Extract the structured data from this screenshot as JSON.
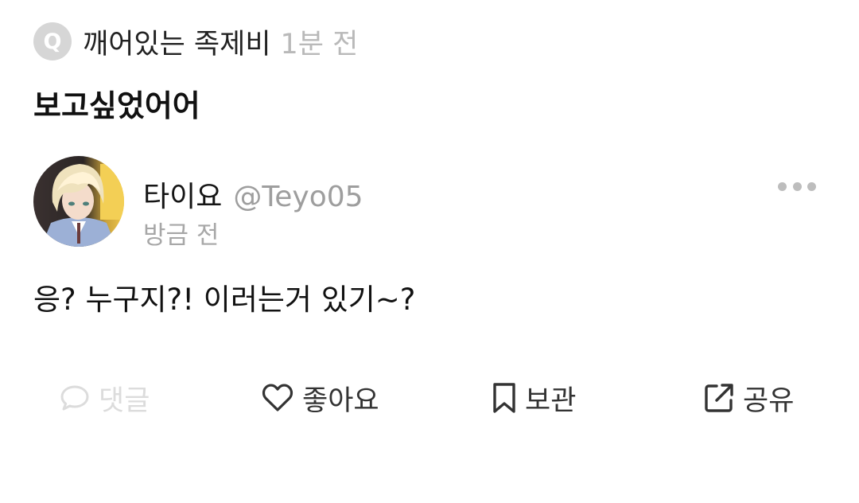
{
  "question": {
    "badge_letter": "Q",
    "asker_name": "깨어있는 족제비",
    "time": "1분 전",
    "text": "보고싶었어어"
  },
  "answer": {
    "author_name": "타이요",
    "author_handle": "@Teyo05",
    "time": "방금 전",
    "text": "응? 누구지?! 이러는거 있기~?"
  },
  "actions": {
    "comment_label": "댓글",
    "like_label": "좋아요",
    "save_label": "보관",
    "share_label": "공유"
  },
  "icons": {
    "question_badge": "q-circle-icon",
    "more": "more-dots-icon",
    "comment": "speech-bubble-icon",
    "like": "heart-outline-icon",
    "save": "bookmark-outline-icon",
    "share": "share-external-icon"
  },
  "colors": {
    "badge_bg": "#d6d6d6",
    "muted_text": "#a7a7a7",
    "disabled_action": "#dcdcdc",
    "action_text": "#333333"
  }
}
